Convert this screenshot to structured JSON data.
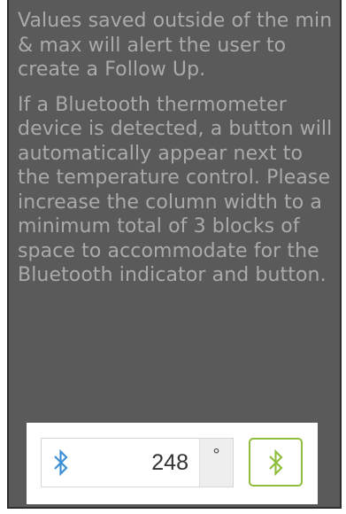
{
  "help": {
    "paragraph1": "Values saved outside of the min & max will alert the user to create a Follow Up.",
    "paragraph2": "If a Bluetooth thermometer device is detected, a button will automatically appear next to the temperature control. Please increase the column width to a minimum total of 3 blocks of space to accommodate for the Bluetooth indicator and button."
  },
  "temperature_control": {
    "indicator_icon": "bluetooth-icon",
    "value": "248",
    "unit": "°"
  },
  "bluetooth_button": {
    "icon": "bluetooth-icon"
  },
  "colors": {
    "panel_background": "#5a5a5a",
    "help_text": "#aaaaaa",
    "bluetooth_indicator": "#3d8fd6",
    "bluetooth_button_accent": "#8fbd3e"
  }
}
